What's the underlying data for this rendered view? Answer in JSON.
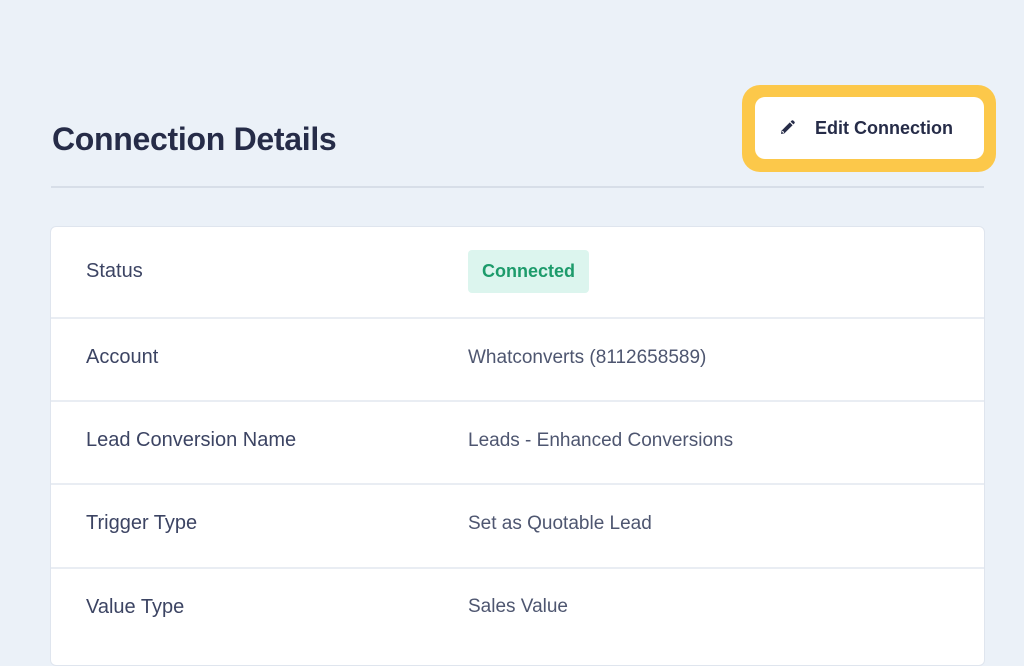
{
  "header": {
    "title": "Connection Details",
    "edit_button_label": "Edit Connection",
    "edit_icon": "pencil-icon"
  },
  "details": {
    "status": {
      "label": "Status",
      "value": "Connected",
      "badge_bg": "#dcf5ee",
      "badge_color": "#1d9b6b"
    },
    "rows": [
      {
        "label": "Account",
        "value": "Whatconverts (8112658589)"
      },
      {
        "label": "Lead Conversion Name",
        "value": "Leads - Enhanced Conversions"
      },
      {
        "label": "Trigger Type",
        "value": "Set as Quotable Lead"
      },
      {
        "label": "Value Type",
        "value": "Sales Value"
      }
    ]
  },
  "colors": {
    "background": "#ebf1f8",
    "highlight": "#fcc84a",
    "title": "#262c48"
  }
}
